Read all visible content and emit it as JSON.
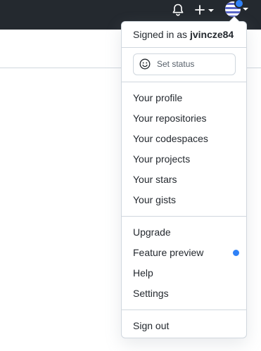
{
  "header": {
    "icons": {
      "notifications": "bell-icon",
      "create": "plus-icon",
      "avatar": "avatar-icon"
    },
    "colors": {
      "topbar": "#24292f",
      "accent": "#2f81f7"
    }
  },
  "user_menu": {
    "signed_in_prefix": "Signed in as",
    "username": "jvincze84",
    "set_status_label": "Set status",
    "profile_items": [
      {
        "label": "Your profile"
      },
      {
        "label": "Your repositories"
      },
      {
        "label": "Your codespaces"
      },
      {
        "label": "Your projects"
      },
      {
        "label": "Your stars"
      },
      {
        "label": "Your gists"
      }
    ],
    "misc_items": [
      {
        "label": "Upgrade"
      },
      {
        "label": "Feature preview",
        "indicator": "blue-dot"
      },
      {
        "label": "Help"
      },
      {
        "label": "Settings"
      }
    ],
    "sign_out_label": "Sign out"
  }
}
